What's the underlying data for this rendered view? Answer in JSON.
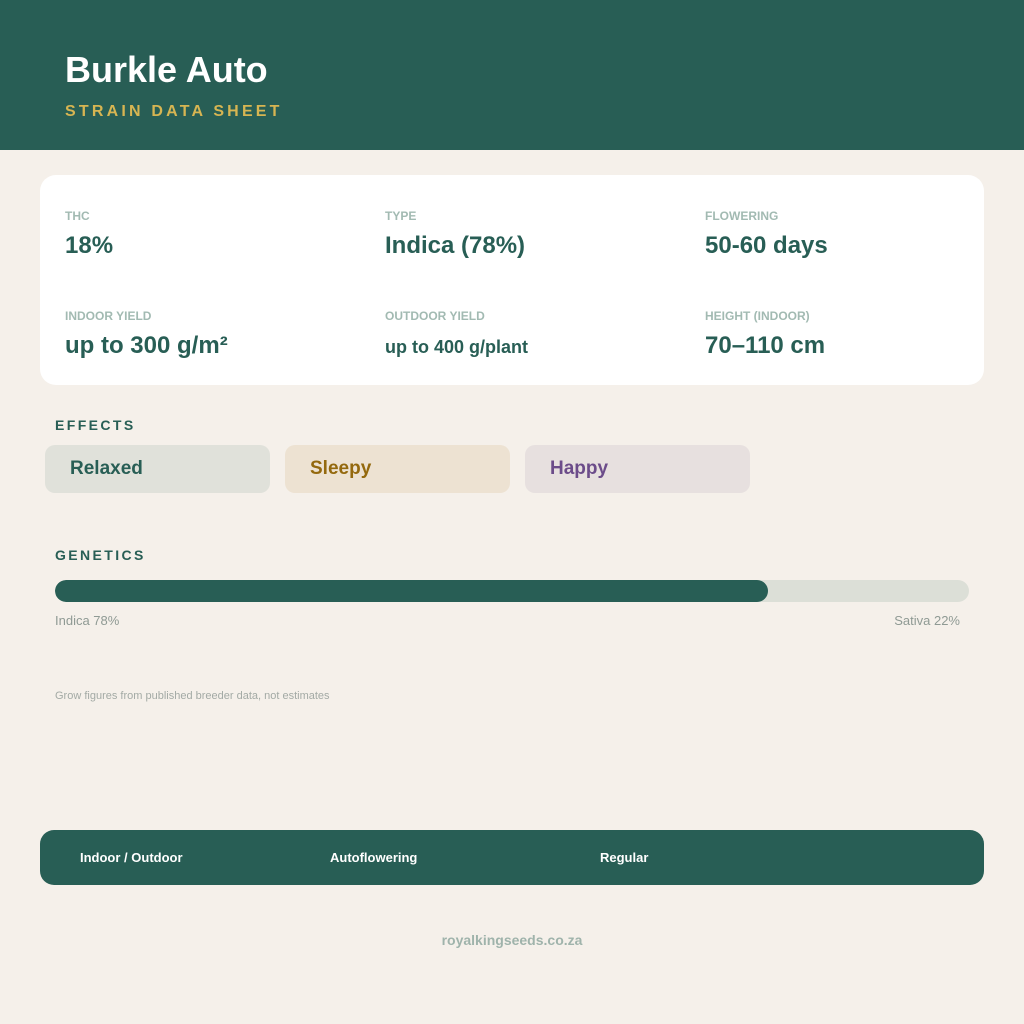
{
  "header": {
    "title": "Burkle Auto",
    "subtitle": "STRAIN DATA SHEET"
  },
  "stats": {
    "thc": {
      "label": "THC",
      "value": "18%"
    },
    "type": {
      "label": "TYPE",
      "value": "Indica (78%)"
    },
    "flowering": {
      "label": "FLOWERING",
      "value": "50-60 days"
    },
    "indoor_yield": {
      "label": "INDOOR YIELD",
      "value": "up to 300 g/m²"
    },
    "outdoor_yield": {
      "label": "OUTDOOR YIELD",
      "value": "up to 400 g/plant"
    },
    "height_indoor": {
      "label": "HEIGHT (INDOOR)",
      "value": "70–110 cm"
    }
  },
  "effects": {
    "label": "EFFECTS",
    "items": [
      {
        "label": "Relaxed",
        "bg": "#e0e1da",
        "color": "#285e55"
      },
      {
        "label": "Sleepy",
        "bg": "#ede2d2",
        "color": "#94690e"
      },
      {
        "label": "Happy",
        "bg": "#e7e0df",
        "color": "#6c4c8a"
      }
    ]
  },
  "genetics": {
    "label": "GENETICS",
    "indica_percent": 78,
    "indica_label": "Indica 78%",
    "sativa_label": "Sativa 22%"
  },
  "note": "Grow figures from published breeder data, not estimates",
  "footer": {
    "items": [
      "Indoor / Outdoor",
      "Autoflowering",
      "Regular"
    ]
  },
  "website": "royalkingseeds.co.za",
  "colors": {
    "brand": "#285e55",
    "accent": "#d7b552",
    "background": "#f5f0ea"
  }
}
